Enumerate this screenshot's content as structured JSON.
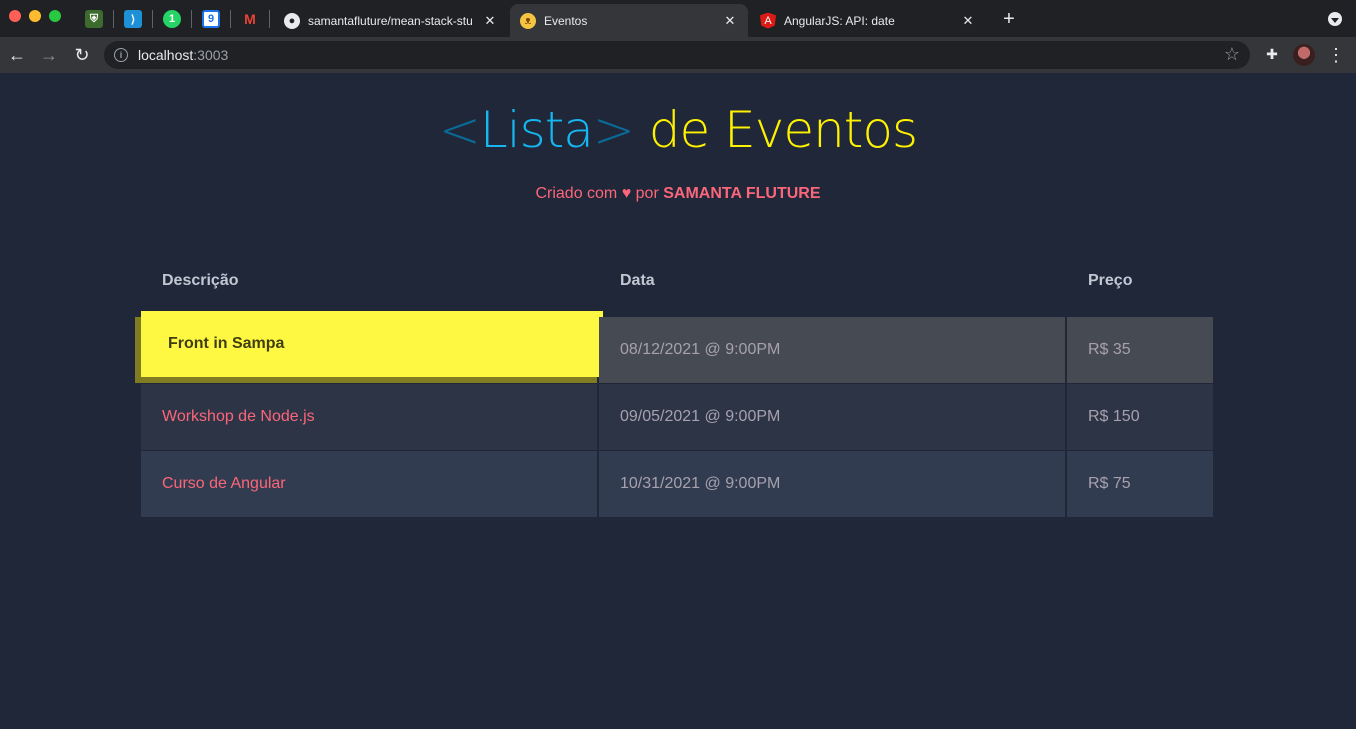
{
  "browser": {
    "pinned_tabs": [
      {
        "icon": "coat-of-arms-icon"
      },
      {
        "icon": "bracket-app-icon"
      },
      {
        "icon": "whatsapp-icon",
        "badge": "1"
      },
      {
        "icon": "calendar-icon",
        "badge": "9"
      },
      {
        "icon": "gmail-icon"
      }
    ],
    "tabs": [
      {
        "title": "samantafluture/mean-stack-stu",
        "icon": "github-icon",
        "active": false
      },
      {
        "title": "Eventos",
        "icon": "cat-icon",
        "active": true
      },
      {
        "title": "AngularJS: API: date",
        "icon": "angular-icon",
        "active": false
      }
    ],
    "url_host": "localhost",
    "url_port": ":3003"
  },
  "page": {
    "title_bracket_open": "<",
    "title_word": "Lista",
    "title_bracket_close": ">",
    "title_rest": " de Eventos",
    "subtitle_prefix": "Criado com ",
    "subtitle_heart": "♥",
    "subtitle_mid": " por ",
    "subtitle_author": "SAMANTA FLUTURE"
  },
  "table": {
    "headers": [
      "Descrição",
      "Data",
      "Preço"
    ],
    "rows": [
      {
        "descricao": "Front in Sampa",
        "data": "08/12/2021 @ 9:00PM",
        "preco": "R$ 35"
      },
      {
        "descricao": "Workshop de Node.js",
        "data": "09/05/2021 @ 9:00PM",
        "preco": "R$ 150"
      },
      {
        "descricao": "Curso de Angular",
        "data": "10/31/2021 @ 9:00PM",
        "preco": "R$ 75"
      }
    ]
  },
  "colors": {
    "background": "#1f2739",
    "title_cyan": "#16b6f0",
    "title_yellow": "#fff200",
    "accent_pink": "#fb667a",
    "hover_yellow": "#fff842"
  }
}
